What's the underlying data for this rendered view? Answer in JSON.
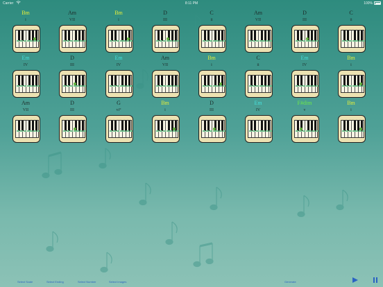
{
  "status_bar": {
    "carrier": "Carrier",
    "time": "8:11 PM",
    "battery": "100%"
  },
  "colors": {
    "background_top": "#2e8b7e",
    "background_bottom": "#8cc2b6",
    "chord_dark": "#1c2a28",
    "chord_yellow": "#e6ef3a",
    "chord_cyan": "#46e0dc",
    "chord_green": "#6de84a",
    "toolbar_link": "#2a62c2",
    "keyboard_card": "#ece2b2",
    "highlight_dot": "#5fae3a"
  },
  "progression": {
    "rows": [
      [
        {
          "chord": "Bm",
          "numeral": "i",
          "color": "yellow",
          "dots": [
            [
              0.8,
              0.45
            ]
          ]
        },
        {
          "chord": "Am",
          "numeral": "VII",
          "color": "dark",
          "dots": []
        },
        {
          "chord": "Bm",
          "numeral": "i",
          "color": "yellow",
          "dots": [
            [
              0.82,
              0.45
            ]
          ]
        },
        {
          "chord": "D",
          "numeral": "III",
          "color": "dark",
          "dots": [
            [
              0.52,
              0.45
            ]
          ]
        },
        {
          "chord": "C",
          "numeral": "ii",
          "color": "dark",
          "dots": []
        },
        {
          "chord": "Am",
          "numeral": "VII",
          "color": "dark",
          "dots": []
        },
        {
          "chord": "D",
          "numeral": "III",
          "color": "dark",
          "dots": [
            [
              0.52,
              0.45
            ]
          ]
        },
        {
          "chord": "C",
          "numeral": "ii",
          "color": "dark",
          "dots": []
        }
      ],
      [
        {
          "chord": "Em",
          "numeral": "IV",
          "color": "cyan",
          "dots": []
        },
        {
          "chord": "D",
          "numeral": "III",
          "color": "dark",
          "dots": [
            [
              0.52,
              0.45
            ]
          ]
        },
        {
          "chord": "Em",
          "numeral": "IV",
          "color": "cyan",
          "dots": []
        },
        {
          "chord": "Am",
          "numeral": "VII",
          "color": "dark",
          "dots": []
        },
        {
          "chord": "Bm",
          "numeral": "i",
          "color": "yellow",
          "dots": [
            [
              0.8,
              0.45
            ]
          ]
        },
        {
          "chord": "C",
          "numeral": "ii",
          "color": "dark",
          "dots": []
        },
        {
          "chord": "Em",
          "numeral": "IV",
          "color": "cyan",
          "dots": []
        },
        {
          "chord": "Bm",
          "numeral": "i",
          "color": "yellow",
          "dots": [
            [
              0.82,
              0.45
            ]
          ]
        }
      ],
      [
        {
          "chord": "Am",
          "numeral": "VII",
          "color": "dark",
          "dots": []
        },
        {
          "chord": "D",
          "numeral": "III",
          "color": "dark",
          "dots": [
            [
              0.52,
              0.45
            ]
          ]
        },
        {
          "chord": "G",
          "numeral": "vi°",
          "color": "dark",
          "dots": []
        },
        {
          "chord": "Bm",
          "numeral": "i",
          "color": "yellow",
          "dots": [
            [
              0.8,
              0.45
            ]
          ]
        },
        {
          "chord": "D",
          "numeral": "III",
          "color": "dark",
          "dots": [
            [
              0.52,
              0.45
            ]
          ]
        },
        {
          "chord": "Em",
          "numeral": "IV",
          "color": "cyan",
          "dots": []
        },
        {
          "chord": "F#dim",
          "numeral": "v",
          "color": "green",
          "dots": [
            [
              0.25,
              0.45
            ]
          ]
        },
        {
          "chord": "Bm",
          "numeral": "i",
          "color": "yellow",
          "dots": [
            [
              0.82,
              0.45
            ]
          ]
        }
      ]
    ]
  },
  "toolbar": {
    "select_scale": "Select Scale",
    "select_ending": "Select Ending",
    "select_number": "Select Number",
    "select_images": "Select Images",
    "generate": "Generate",
    "play_icon": "play-icon",
    "pause_icon": "pause-icon"
  }
}
